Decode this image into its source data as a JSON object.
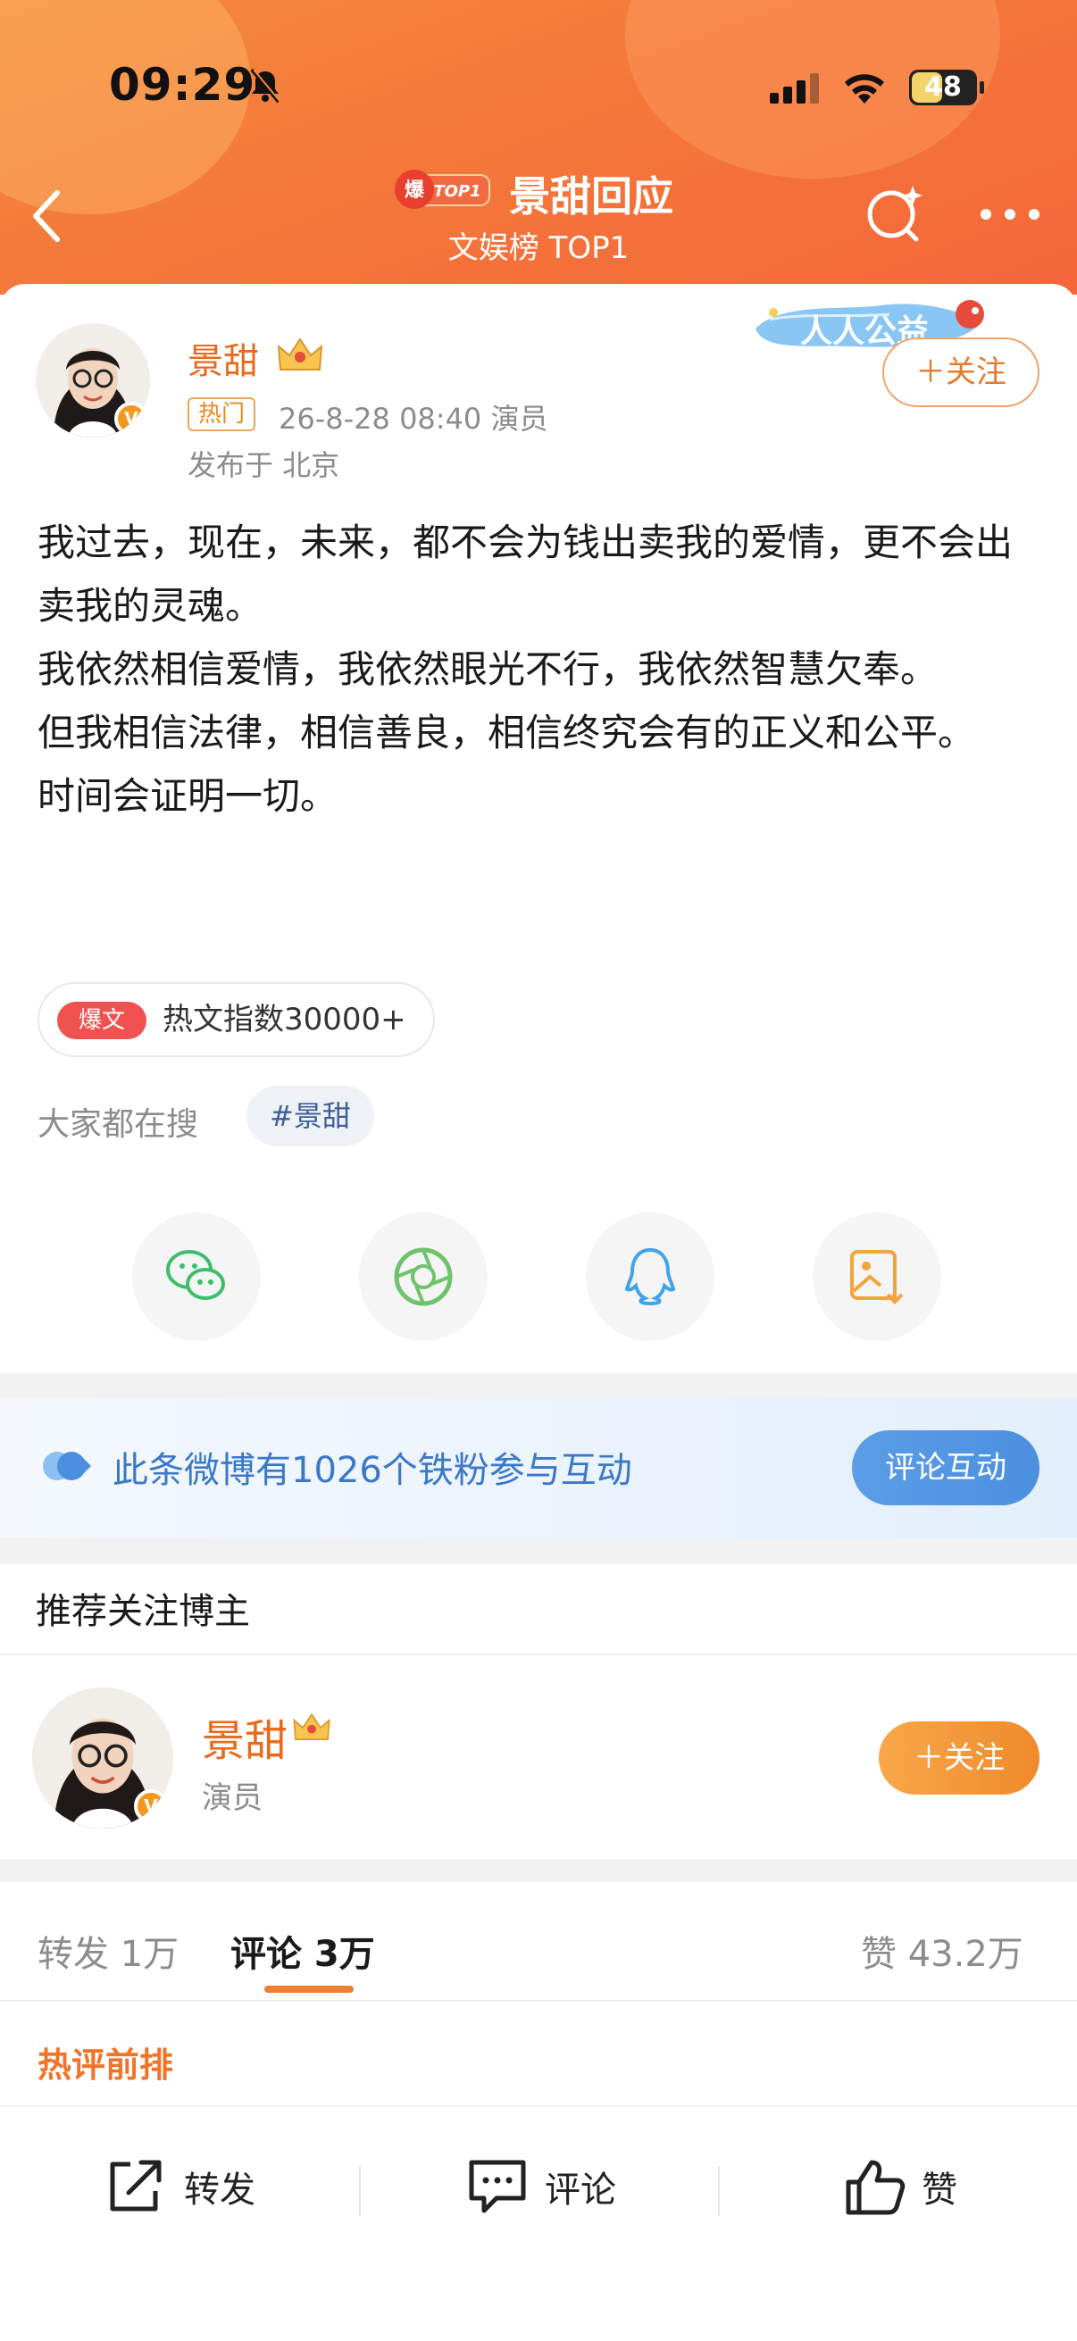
{
  "status_bar": {
    "time": "09:29",
    "battery": "48"
  },
  "nav": {
    "badge": "TOP1",
    "title": "景甜回应",
    "subtitle": "文娱榜 TOP1"
  },
  "post": {
    "author": "景甜",
    "hot_tag": "热门",
    "meta": "26-8-28 08:40   演员",
    "location": "发布于 北京",
    "follow_label": "＋关注",
    "gongyi_label": "人人公益",
    "text": "我过去，现在，未来，都不会为钱出卖我的爱情，更不会出卖我的灵魂。\n我依然相信爱情，我依然眼光不行，我依然智慧欠奉。\n但我相信法律，相信善良，相信终究会有的正义和公平。\n时间会证明一切。",
    "hot_index_pill": "爆文",
    "hot_index_text": "热文指数30000+",
    "search_label": "大家都在搜",
    "search_chip": "#景甜"
  },
  "share": {
    "items": [
      "wechat-icon",
      "moments-icon",
      "qq-icon",
      "save-image-icon"
    ],
    "colors": {
      "wechat": "#3cbf6b",
      "moments": "#6fc36a",
      "qq": "#42a3e8",
      "save": "#f3a43a"
    }
  },
  "fans_banner": {
    "text": "此条微博有1026个铁粉参与互动",
    "button": "评论互动"
  },
  "recommend": {
    "title": "推荐关注博主",
    "name": "景甜",
    "role": "演员",
    "follow_label": "＋关注"
  },
  "tabs": {
    "repost": "转发 1万",
    "comment": "评论 3万",
    "like": "赞 43.2万"
  },
  "hot_comments_label": "热评前排",
  "bottom_bar": {
    "repost": "转发",
    "comment": "评论",
    "like": "赞"
  },
  "accent": "#f07f32"
}
